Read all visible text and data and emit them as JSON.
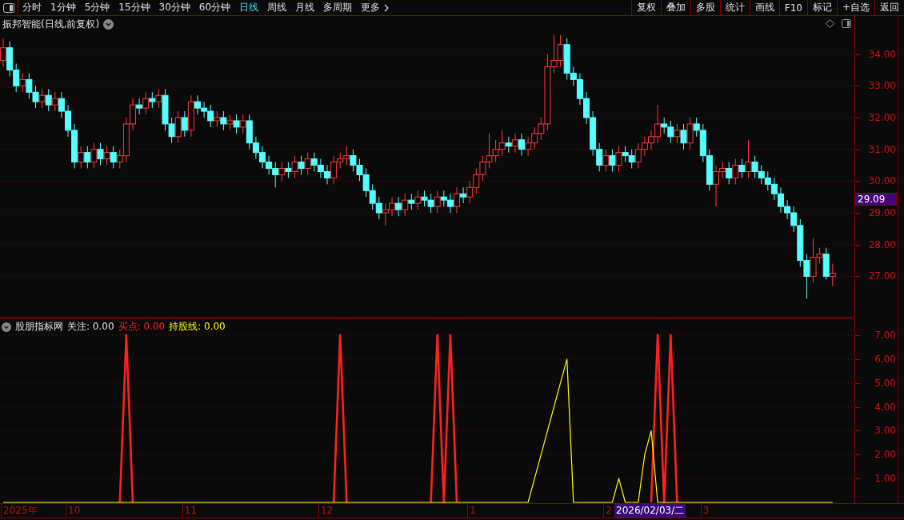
{
  "toolbar": {
    "periods": [
      {
        "label": "分时",
        "selected": false
      },
      {
        "label": "1分钟",
        "selected": false
      },
      {
        "label": "5分钟",
        "selected": false
      },
      {
        "label": "15分钟",
        "selected": false
      },
      {
        "label": "30分钟",
        "selected": false
      },
      {
        "label": "60分钟",
        "selected": false
      },
      {
        "label": "日线",
        "selected": true
      },
      {
        "label": "周线",
        "selected": false
      },
      {
        "label": "月线",
        "selected": false
      },
      {
        "label": "多周期",
        "selected": false
      },
      {
        "label": "更多",
        "selected": false
      }
    ],
    "actions": [
      "复权",
      "叠加",
      "多股",
      "统计",
      "画线",
      "F10",
      "标记",
      "+自选",
      "返回"
    ]
  },
  "price_chart": {
    "title": "振邦智能(日线,前复权)",
    "current_price": "29.09",
    "chart_data": {
      "type": "candlestick",
      "grid": true,
      "ylim": [
        25.7,
        35.2
      ],
      "yticks": [
        {
          "value": 34,
          "label": "34.00"
        },
        {
          "value": 33,
          "label": "33.00"
        },
        {
          "value": 32,
          "label": "32.00"
        },
        {
          "value": 31,
          "label": "31.00"
        },
        {
          "value": 30,
          "label": "30.00"
        },
        {
          "value": 29,
          "label": "29.00"
        },
        {
          "value": 28,
          "label": "28.00"
        },
        {
          "value": 27,
          "label": "27.00"
        }
      ],
      "ohlc": [
        [
          33.8,
          34.5,
          33.6,
          34.2
        ],
        [
          34.2,
          34.4,
          33.3,
          33.5
        ],
        [
          33.5,
          33.7,
          32.8,
          33.0
        ],
        [
          33.0,
          33.4,
          32.8,
          33.2
        ],
        [
          33.2,
          33.4,
          32.6,
          32.8
        ],
        [
          32.8,
          33.0,
          32.3,
          32.5
        ],
        [
          32.5,
          32.9,
          32.3,
          32.7
        ],
        [
          32.7,
          32.9,
          32.2,
          32.4
        ],
        [
          32.4,
          32.8,
          32.2,
          32.6
        ],
        [
          32.6,
          32.8,
          32.0,
          32.2
        ],
        [
          32.2,
          32.4,
          31.4,
          31.6
        ],
        [
          31.6,
          31.8,
          30.4,
          30.6
        ],
        [
          30.6,
          31.1,
          30.4,
          30.9
        ],
        [
          30.9,
          31.1,
          30.4,
          30.6
        ],
        [
          30.6,
          31.2,
          30.4,
          31.0
        ],
        [
          31.0,
          31.2,
          30.5,
          30.7
        ],
        [
          30.7,
          31.1,
          30.5,
          30.9
        ],
        [
          30.9,
          31.1,
          30.4,
          30.6
        ],
        [
          30.6,
          31.0,
          30.4,
          30.8
        ],
        [
          30.8,
          32.0,
          30.6,
          31.8
        ],
        [
          31.8,
          32.6,
          31.6,
          32.4
        ],
        [
          32.4,
          32.6,
          32.1,
          32.3
        ],
        [
          32.3,
          32.8,
          32.1,
          32.6
        ],
        [
          32.6,
          32.8,
          32.3,
          32.5
        ],
        [
          32.5,
          32.9,
          32.3,
          32.7
        ],
        [
          32.7,
          32.9,
          31.6,
          31.8
        ],
        [
          31.8,
          32.0,
          31.2,
          31.4
        ],
        [
          31.4,
          32.2,
          31.2,
          32.0
        ],
        [
          32.0,
          32.2,
          31.4,
          31.6
        ],
        [
          31.6,
          32.7,
          31.4,
          32.5
        ],
        [
          32.5,
          32.7,
          32.1,
          32.3
        ],
        [
          32.3,
          32.5,
          32.0,
          32.2
        ],
        [
          32.2,
          32.4,
          31.7,
          31.9
        ],
        [
          31.9,
          32.2,
          31.7,
          32.0
        ],
        [
          32.0,
          32.2,
          31.6,
          31.8
        ],
        [
          31.8,
          32.1,
          31.6,
          31.9
        ],
        [
          31.9,
          32.1,
          31.5,
          31.7
        ],
        [
          31.7,
          32.1,
          31.5,
          31.9
        ],
        [
          31.9,
          32.1,
          31.0,
          31.2
        ],
        [
          31.2,
          31.4,
          30.7,
          30.9
        ],
        [
          30.9,
          31.1,
          30.4,
          30.6
        ],
        [
          30.6,
          30.8,
          30.2,
          30.4
        ],
        [
          30.4,
          30.6,
          29.8,
          30.2
        ],
        [
          30.2,
          30.6,
          30.0,
          30.4
        ],
        [
          30.4,
          30.6,
          30.1,
          30.3
        ],
        [
          30.3,
          30.8,
          30.1,
          30.6
        ],
        [
          30.6,
          30.8,
          30.2,
          30.4
        ],
        [
          30.4,
          30.9,
          30.2,
          30.7
        ],
        [
          30.7,
          30.9,
          30.3,
          30.5
        ],
        [
          30.5,
          30.7,
          30.1,
          30.3
        ],
        [
          30.3,
          30.5,
          29.9,
          30.1
        ],
        [
          30.1,
          30.8,
          29.9,
          30.6
        ],
        [
          30.6,
          30.9,
          30.4,
          30.7
        ],
        [
          30.7,
          31.1,
          30.5,
          30.8
        ],
        [
          30.8,
          31.0,
          30.3,
          30.5
        ],
        [
          30.5,
          30.7,
          30.0,
          30.2
        ],
        [
          30.2,
          30.4,
          29.5,
          29.7
        ],
        [
          29.7,
          29.9,
          29.1,
          29.3
        ],
        [
          29.3,
          29.5,
          28.8,
          29.0
        ],
        [
          29.0,
          29.3,
          28.6,
          29.1
        ],
        [
          29.1,
          29.5,
          28.9,
          29.3
        ],
        [
          29.3,
          29.5,
          28.9,
          29.1
        ],
        [
          29.1,
          29.6,
          28.9,
          29.4
        ],
        [
          29.4,
          29.6,
          29.1,
          29.3
        ],
        [
          29.3,
          29.7,
          29.1,
          29.5
        ],
        [
          29.5,
          29.7,
          29.2,
          29.4
        ],
        [
          29.4,
          29.6,
          29.0,
          29.2
        ],
        [
          29.2,
          29.7,
          29.0,
          29.5
        ],
        [
          29.5,
          29.7,
          29.2,
          29.4
        ],
        [
          29.4,
          29.6,
          29.0,
          29.2
        ],
        [
          29.2,
          29.8,
          29.0,
          29.6
        ],
        [
          29.6,
          29.8,
          29.3,
          29.5
        ],
        [
          29.5,
          30.0,
          29.3,
          29.8
        ],
        [
          29.8,
          30.4,
          29.6,
          30.2
        ],
        [
          30.2,
          30.8,
          30.0,
          30.6
        ],
        [
          30.6,
          31.5,
          30.4,
          30.8
        ],
        [
          30.8,
          31.3,
          30.6,
          31.0
        ],
        [
          31.0,
          31.6,
          30.8,
          31.2
        ],
        [
          31.2,
          31.4,
          30.9,
          31.1
        ],
        [
          31.1,
          31.5,
          30.9,
          31.3
        ],
        [
          31.3,
          31.5,
          30.8,
          31.0
        ],
        [
          31.0,
          31.4,
          30.8,
          31.2
        ],
        [
          31.2,
          31.7,
          31.0,
          31.5
        ],
        [
          31.5,
          32.0,
          31.3,
          31.8
        ],
        [
          31.8,
          34.0,
          31.6,
          33.6
        ],
        [
          33.6,
          34.6,
          33.4,
          33.8
        ],
        [
          33.8,
          34.6,
          33.6,
          34.3
        ],
        [
          34.3,
          34.5,
          33.2,
          33.4
        ],
        [
          33.4,
          33.6,
          33.0,
          33.2
        ],
        [
          33.2,
          33.4,
          32.4,
          32.6
        ],
        [
          32.6,
          32.8,
          31.8,
          32.0
        ],
        [
          32.0,
          32.2,
          30.8,
          31.0
        ],
        [
          31.0,
          31.2,
          30.3,
          30.5
        ],
        [
          30.5,
          31.0,
          30.3,
          30.8
        ],
        [
          30.8,
          31.0,
          30.3,
          30.5
        ],
        [
          30.5,
          31.1,
          30.3,
          30.9
        ],
        [
          30.9,
          31.1,
          30.6,
          30.8
        ],
        [
          30.8,
          31.0,
          30.4,
          30.6
        ],
        [
          30.6,
          31.2,
          30.4,
          31.0
        ],
        [
          31.0,
          31.4,
          30.8,
          31.2
        ],
        [
          31.2,
          31.6,
          31.0,
          31.4
        ],
        [
          31.4,
          32.4,
          31.2,
          31.8
        ],
        [
          31.8,
          32.0,
          31.5,
          31.7
        ],
        [
          31.7,
          31.9,
          31.2,
          31.4
        ],
        [
          31.4,
          31.8,
          31.2,
          31.6
        ],
        [
          31.6,
          31.8,
          31.0,
          31.2
        ],
        [
          31.2,
          32.0,
          31.0,
          31.8
        ],
        [
          31.8,
          32.0,
          31.4,
          31.6
        ],
        [
          31.6,
          31.8,
          30.6,
          30.8
        ],
        [
          30.8,
          31.0,
          29.7,
          29.9
        ],
        [
          29.9,
          30.5,
          29.2,
          30.3
        ],
        [
          30.3,
          30.6,
          30.1,
          30.4
        ],
        [
          30.4,
          30.6,
          29.9,
          30.1
        ],
        [
          30.1,
          30.7,
          29.9,
          30.5
        ],
        [
          30.5,
          30.7,
          30.1,
          30.3
        ],
        [
          30.3,
          31.3,
          30.1,
          30.6
        ],
        [
          30.6,
          30.8,
          30.1,
          30.3
        ],
        [
          30.3,
          30.5,
          29.9,
          30.1
        ],
        [
          30.1,
          30.3,
          29.7,
          29.9
        ],
        [
          29.9,
          30.1,
          29.4,
          29.6
        ],
        [
          29.6,
          29.8,
          29.0,
          29.2
        ],
        [
          29.2,
          29.4,
          28.8,
          29.0
        ],
        [
          29.0,
          29.2,
          28.4,
          28.6
        ],
        [
          28.6,
          28.8,
          27.3,
          27.5
        ],
        [
          27.5,
          27.7,
          26.3,
          27.0
        ],
        [
          27.0,
          28.2,
          26.8,
          27.6
        ],
        [
          27.6,
          27.9,
          27.4,
          27.7
        ],
        [
          27.7,
          27.9,
          26.9,
          27.0
        ],
        [
          27.0,
          27.4,
          26.7,
          27.1
        ]
      ]
    }
  },
  "indicator": {
    "name": "股朋指标网",
    "watch": "关注: 0.00",
    "readouts": [
      ": 0.00",
      ": 0.00"
    ],
    "chart_data": {
      "type": "line",
      "grid": true,
      "ylim": [
        0,
        7.7
      ],
      "yticks": [
        {
          "value": 1,
          "label": "1.00"
        },
        {
          "value": 2,
          "label": "2.00"
        },
        {
          "value": 3,
          "label": "3.00"
        },
        {
          "value": 4,
          "label": "4.00"
        },
        {
          "value": 5,
          "label": "5.00"
        },
        {
          "value": 6,
          "label": "6.00"
        },
        {
          "value": 7,
          "label": "7.00"
        }
      ],
      "series": [
        {
          "name": "买点",
          "color": "#ff2020",
          "values": [
            null,
            null,
            null,
            null,
            null,
            null,
            null,
            null,
            null,
            null,
            null,
            null,
            null,
            null,
            null,
            null,
            null,
            null,
            0,
            7,
            0,
            null,
            null,
            null,
            null,
            null,
            null,
            null,
            null,
            null,
            null,
            null,
            null,
            null,
            null,
            null,
            null,
            null,
            null,
            null,
            null,
            null,
            null,
            null,
            null,
            null,
            null,
            null,
            null,
            null,
            null,
            0,
            7,
            0,
            null,
            null,
            null,
            null,
            null,
            null,
            null,
            null,
            null,
            null,
            null,
            null,
            0,
            7,
            0,
            7,
            0,
            null,
            null,
            null,
            null,
            null,
            null,
            null,
            null,
            null,
            null,
            null,
            null,
            null,
            null,
            null,
            null,
            null,
            null,
            null,
            null,
            null,
            null,
            null,
            null,
            null,
            null,
            null,
            null,
            null,
            0,
            7,
            0,
            7,
            0,
            null,
            null,
            null,
            null,
            null,
            null,
            null,
            null,
            null,
            null,
            null,
            null,
            null,
            null,
            null,
            null,
            null,
            null,
            null,
            null,
            null,
            null,
            null,
            null
          ]
        },
        {
          "name": "持股线",
          "color": "#ffff00",
          "values": [
            0,
            0,
            0,
            0,
            0,
            0,
            0,
            0,
            0,
            0,
            0,
            0,
            0,
            0,
            0,
            0,
            0,
            0,
            0,
            0,
            0,
            0,
            0,
            0,
            0,
            0,
            0,
            0,
            0,
            0,
            0,
            0,
            0,
            0,
            0,
            0,
            0,
            0,
            0,
            0,
            0,
            0,
            0,
            0,
            0,
            0,
            0,
            0,
            0,
            0,
            0,
            0,
            0,
            0,
            0,
            0,
            0,
            0,
            0,
            0,
            0,
            0,
            0,
            0,
            0,
            0,
            0,
            0,
            0,
            0,
            0,
            0,
            0,
            0,
            0,
            0,
            0,
            0,
            0,
            0,
            0,
            0,
            1,
            2,
            3,
            4,
            5,
            6,
            0,
            0,
            0,
            0,
            0,
            0,
            0,
            1,
            0,
            0,
            0,
            2,
            3,
            0,
            0,
            0,
            0,
            0,
            0,
            0,
            0,
            0,
            0,
            0,
            0,
            0,
            0,
            0,
            0,
            0,
            0,
            0,
            0,
            0,
            0,
            0,
            0,
            0,
            0,
            0,
            0
          ]
        }
      ]
    }
  },
  "time_axis": {
    "labels": [
      "2025年",
      "10",
      "11",
      "12",
      "1",
      "2",
      "3"
    ],
    "cursor_date": "2026/02/03/二"
  }
}
